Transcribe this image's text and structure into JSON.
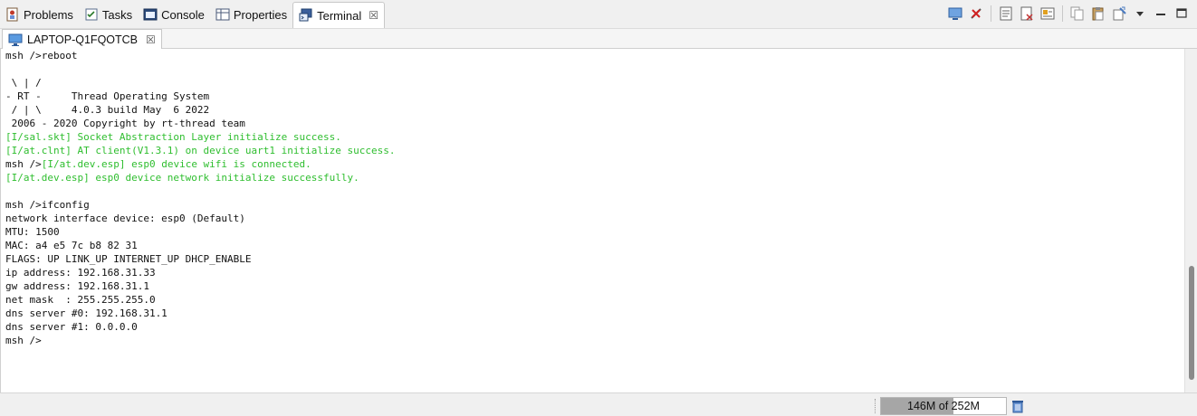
{
  "view_tabs": [
    {
      "label": "Problems",
      "icon": "problems-icon"
    },
    {
      "label": "Tasks",
      "icon": "tasks-icon"
    },
    {
      "label": "Console",
      "icon": "console-icon"
    },
    {
      "label": "Properties",
      "icon": "properties-icon"
    },
    {
      "label": "Terminal",
      "icon": "terminal-icon",
      "active": true,
      "close": "☒"
    }
  ],
  "session_tab": {
    "label": "LAPTOP-Q1FQOTCB",
    "close": "☒"
  },
  "terminal_lines": [
    {
      "text": "msh />reboot",
      "style": "plain"
    },
    {
      "text": "",
      "style": "plain"
    },
    {
      "text": " \\ | /",
      "style": "plain"
    },
    {
      "text": "- RT -     Thread Operating System",
      "style": "plain"
    },
    {
      "text": " / | \\     4.0.3 build May  6 2022",
      "style": "plain"
    },
    {
      "text": " 2006 - 2020 Copyright by rt-thread team",
      "style": "plain"
    },
    {
      "text": "[I/sal.skt] Socket Abstraction Layer initialize success.",
      "style": "green"
    },
    {
      "text": "[I/at.clnt] AT client(V1.3.1) on device uart1 initialize success.",
      "style": "green"
    },
    {
      "prefix": "msh />",
      "text": "[I/at.dev.esp] esp0 device wifi is connected.",
      "style": "mixed"
    },
    {
      "text": "[I/at.dev.esp] esp0 device network initialize successfully.",
      "style": "green"
    },
    {
      "text": "",
      "style": "plain"
    },
    {
      "text": "msh />ifconfig",
      "style": "plain"
    },
    {
      "text": "network interface device: esp0 (Default)",
      "style": "plain"
    },
    {
      "text": "MTU: 1500",
      "style": "plain"
    },
    {
      "text": "MAC: a4 e5 7c b8 82 31",
      "style": "plain"
    },
    {
      "text": "FLAGS: UP LINK_UP INTERNET_UP DHCP_ENABLE",
      "style": "plain"
    },
    {
      "text": "ip address: 192.168.31.33",
      "style": "plain"
    },
    {
      "text": "gw address: 192.168.31.1",
      "style": "plain"
    },
    {
      "text": "net mask  : 255.255.255.0",
      "style": "plain"
    },
    {
      "text": "dns server #0: 192.168.31.1",
      "style": "plain"
    },
    {
      "text": "dns server #1: 0.0.0.0",
      "style": "plain"
    },
    {
      "text": "msh />",
      "style": "plain"
    }
  ],
  "colors": {
    "success_green": "#2fbe2f",
    "heap_fill": "#a6a6a6"
  },
  "status": {
    "heap_label": "146M of 252M",
    "heap_used_mb": 146,
    "heap_total_mb": 252
  },
  "toolbar_icons": [
    "minimize-view-icon",
    "disconnect-icon",
    "new-terminal-icon",
    "scroll-lock-icon",
    "terminal-settings-icon",
    "copy-icon",
    "paste-icon",
    "clear-console-icon",
    "view-menu-icon",
    "minimize-icon",
    "maximize-icon"
  ]
}
